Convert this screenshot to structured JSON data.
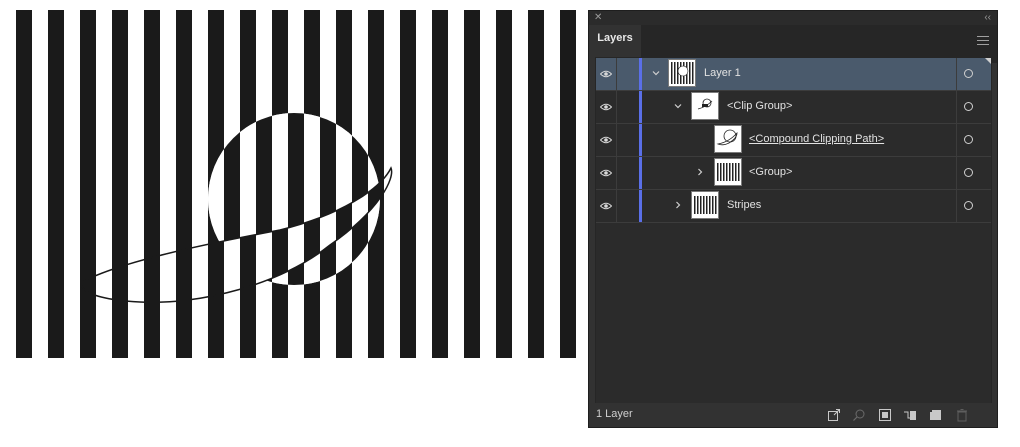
{
  "panel": {
    "tab_label": "Layers",
    "close_icon": "close-icon",
    "collapse_icon": "double-chevron-left-icon",
    "menu_icon": "hamburger-menu-icon",
    "footer_status": "1 Layer"
  },
  "layers": [
    {
      "name": "Layer 1",
      "visible": true,
      "expanded": true,
      "selected": true,
      "depth": 0
    },
    {
      "name": "<Clip Group>",
      "visible": true,
      "expanded": true,
      "selected": false,
      "depth": 1
    },
    {
      "name": "<Compound Clipping Path>",
      "visible": true,
      "expanded": false,
      "selected": false,
      "depth": 2,
      "underlined": true
    },
    {
      "name": "<Group>",
      "visible": true,
      "expanded": false,
      "selected": false,
      "depth": 2
    },
    {
      "name": "Stripes",
      "visible": true,
      "expanded": false,
      "selected": false,
      "depth": 1
    }
  ],
  "footer_icons": [
    "export-icon",
    "locate-object-icon",
    "make-clipping-mask-icon",
    "create-sublayer-icon",
    "new-layer-icon",
    "delete-icon"
  ],
  "colors": {
    "layer_color": "#5a6fe8",
    "selected_row": "#4a5a6c",
    "panel_bg": "#323232"
  }
}
